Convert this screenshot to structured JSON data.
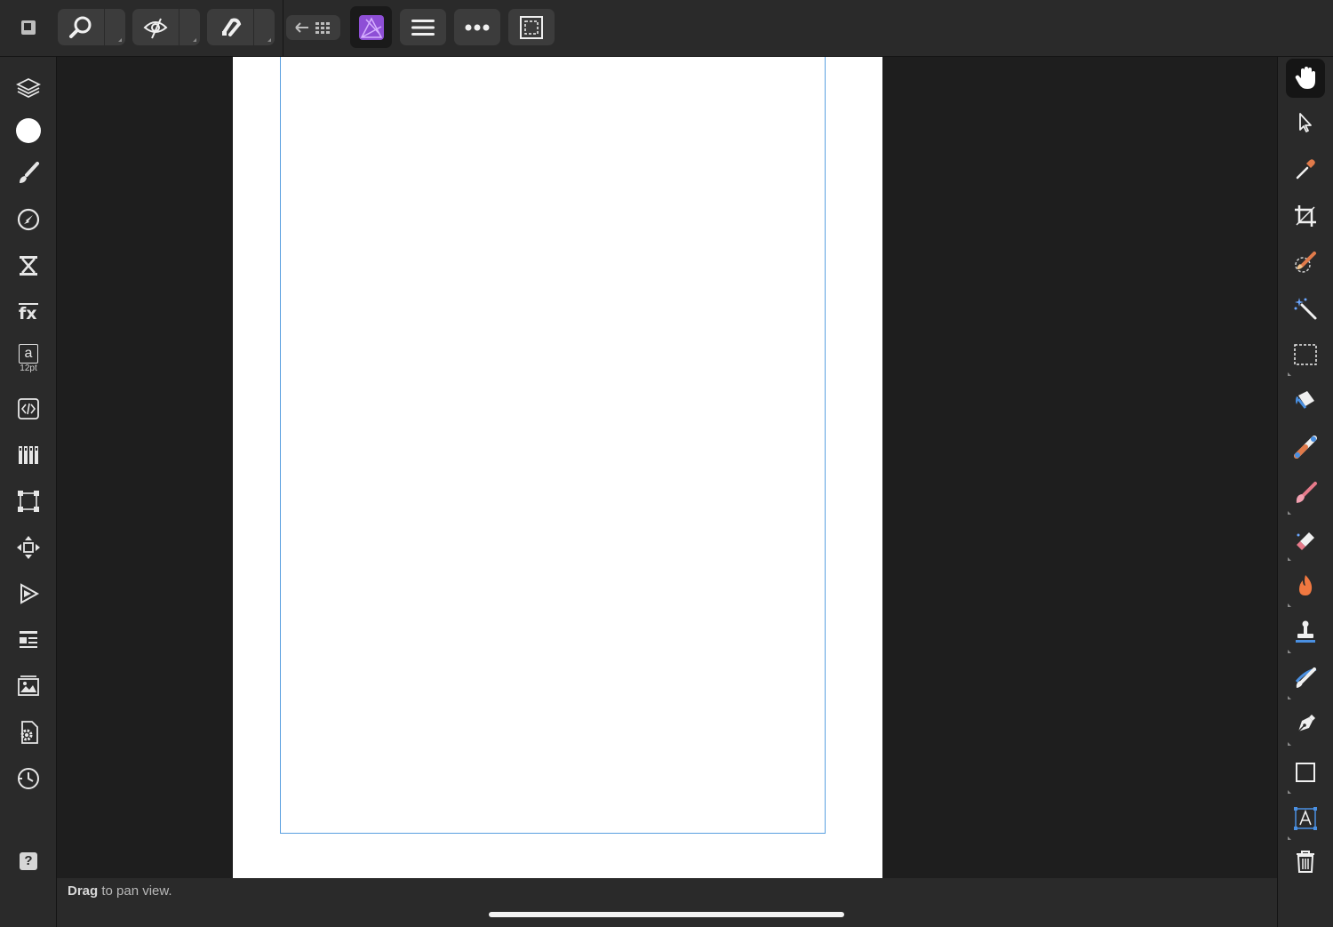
{
  "status_bar": {
    "hint_bold": "Drag",
    "hint_rest": " to pan view."
  },
  "left_tools": [
    {
      "name": "layers-icon"
    },
    {
      "name": "colour-icon"
    },
    {
      "name": "brushes-icon"
    },
    {
      "name": "adjustments-icon"
    },
    {
      "name": "channels-icon"
    },
    {
      "name": "fx-icon"
    },
    {
      "name": "text-style-icon",
      "sublabel": "12pt"
    },
    {
      "name": "stock-icon"
    },
    {
      "name": "swatches-icon"
    },
    {
      "name": "transform-icon"
    },
    {
      "name": "navigator-icon"
    },
    {
      "name": "macro-icon"
    },
    {
      "name": "library-icon"
    },
    {
      "name": "assets-icon"
    },
    {
      "name": "settings-icon"
    },
    {
      "name": "history-icon"
    },
    {
      "name": "help-icon",
      "label": "?"
    }
  ],
  "text_tool": {
    "label": "a",
    "sublabel": "12pt"
  },
  "help_label": "?",
  "colors": {
    "toolbar": "#2a2a2a",
    "canvas_bg": "#1e1e1e",
    "page": "#ffffff",
    "guide": "#5aa0e0",
    "accent_purple": "#8e4fd6"
  }
}
